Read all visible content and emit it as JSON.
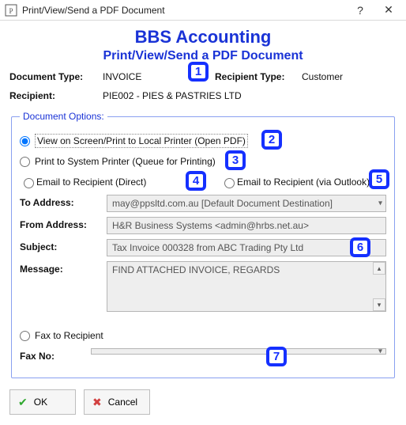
{
  "window": {
    "title": "Print/View/Send a PDF Document"
  },
  "header": {
    "app_name": "BBS Accounting",
    "subtitle": "Print/View/Send a PDF Document"
  },
  "info": {
    "doc_type_lbl": "Document Type:",
    "doc_type_val": "INVOICE",
    "recip_type_lbl": "Recipient Type:",
    "recip_type_val": "Customer",
    "recip_lbl": "Recipient:",
    "recip_val": "PIE002 - PIES & PASTRIES LTD"
  },
  "options": {
    "legend": "Document Options:",
    "opt_view": "View on Screen/Print to Local Printer (Open PDF)",
    "opt_sys": "Print to System Printer (Queue for Printing)",
    "opt_email_direct": "Email to Recipient (Direct)",
    "opt_email_outlook": "Email to Recipient (via Outlook)",
    "to_lbl": "To Address:",
    "to_val": "may@ppsltd.com.au [Default Document Destination]",
    "from_lbl": "From Address:",
    "from_val": "H&R Business Systems <admin@hrbs.net.au>",
    "subject_lbl": "Subject:",
    "subject_val": "Tax Invoice 000328 from ABC Trading Pty Ltd",
    "message_lbl": "Message:",
    "message_val": "FIND ATTACHED INVOICE, REGARDS",
    "opt_fax": "Fax to Recipient",
    "fax_lbl": "Fax No:",
    "fax_val": ""
  },
  "buttons": {
    "ok": "OK",
    "cancel": "Cancel"
  },
  "callouts": {
    "c1": "1",
    "c2": "2",
    "c3": "3",
    "c4": "4",
    "c5": "5",
    "c6": "6",
    "c7": "7"
  }
}
